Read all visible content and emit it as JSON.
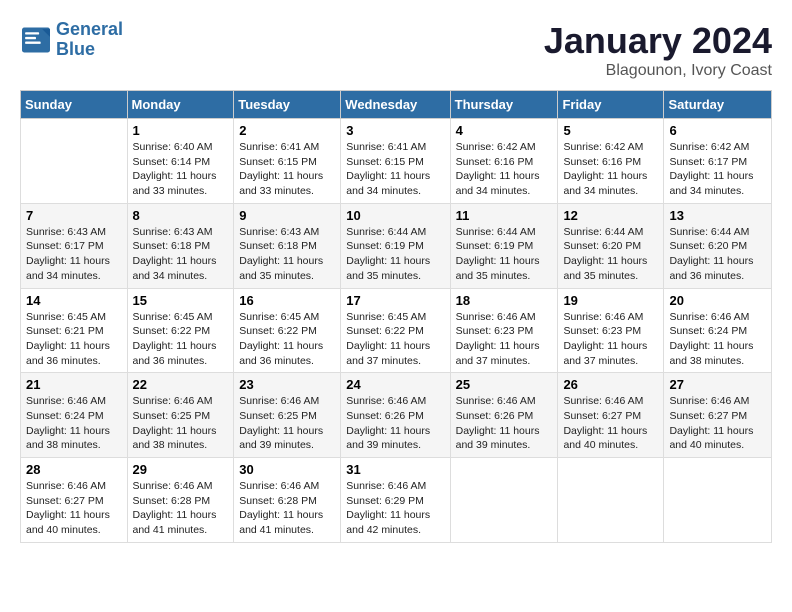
{
  "header": {
    "logo_line1": "General",
    "logo_line2": "Blue",
    "month": "January 2024",
    "location": "Blagounon, Ivory Coast"
  },
  "days_of_week": [
    "Sunday",
    "Monday",
    "Tuesday",
    "Wednesday",
    "Thursday",
    "Friday",
    "Saturday"
  ],
  "weeks": [
    [
      {
        "day": null
      },
      {
        "day": "1",
        "sunrise": "6:40 AM",
        "sunset": "6:14 PM",
        "daylight": "11 hours and 33 minutes."
      },
      {
        "day": "2",
        "sunrise": "6:41 AM",
        "sunset": "6:15 PM",
        "daylight": "11 hours and 33 minutes."
      },
      {
        "day": "3",
        "sunrise": "6:41 AM",
        "sunset": "6:15 PM",
        "daylight": "11 hours and 34 minutes."
      },
      {
        "day": "4",
        "sunrise": "6:42 AM",
        "sunset": "6:16 PM",
        "daylight": "11 hours and 34 minutes."
      },
      {
        "day": "5",
        "sunrise": "6:42 AM",
        "sunset": "6:16 PM",
        "daylight": "11 hours and 34 minutes."
      },
      {
        "day": "6",
        "sunrise": "6:42 AM",
        "sunset": "6:17 PM",
        "daylight": "11 hours and 34 minutes."
      }
    ],
    [
      {
        "day": "7",
        "sunrise": "6:43 AM",
        "sunset": "6:17 PM",
        "daylight": "11 hours and 34 minutes."
      },
      {
        "day": "8",
        "sunrise": "6:43 AM",
        "sunset": "6:18 PM",
        "daylight": "11 hours and 34 minutes."
      },
      {
        "day": "9",
        "sunrise": "6:43 AM",
        "sunset": "6:18 PM",
        "daylight": "11 hours and 35 minutes."
      },
      {
        "day": "10",
        "sunrise": "6:44 AM",
        "sunset": "6:19 PM",
        "daylight": "11 hours and 35 minutes."
      },
      {
        "day": "11",
        "sunrise": "6:44 AM",
        "sunset": "6:19 PM",
        "daylight": "11 hours and 35 minutes."
      },
      {
        "day": "12",
        "sunrise": "6:44 AM",
        "sunset": "6:20 PM",
        "daylight": "11 hours and 35 minutes."
      },
      {
        "day": "13",
        "sunrise": "6:44 AM",
        "sunset": "6:20 PM",
        "daylight": "11 hours and 36 minutes."
      }
    ],
    [
      {
        "day": "14",
        "sunrise": "6:45 AM",
        "sunset": "6:21 PM",
        "daylight": "11 hours and 36 minutes."
      },
      {
        "day": "15",
        "sunrise": "6:45 AM",
        "sunset": "6:22 PM",
        "daylight": "11 hours and 36 minutes."
      },
      {
        "day": "16",
        "sunrise": "6:45 AM",
        "sunset": "6:22 PM",
        "daylight": "11 hours and 36 minutes."
      },
      {
        "day": "17",
        "sunrise": "6:45 AM",
        "sunset": "6:22 PM",
        "daylight": "11 hours and 37 minutes."
      },
      {
        "day": "18",
        "sunrise": "6:46 AM",
        "sunset": "6:23 PM",
        "daylight": "11 hours and 37 minutes."
      },
      {
        "day": "19",
        "sunrise": "6:46 AM",
        "sunset": "6:23 PM",
        "daylight": "11 hours and 37 minutes."
      },
      {
        "day": "20",
        "sunrise": "6:46 AM",
        "sunset": "6:24 PM",
        "daylight": "11 hours and 38 minutes."
      }
    ],
    [
      {
        "day": "21",
        "sunrise": "6:46 AM",
        "sunset": "6:24 PM",
        "daylight": "11 hours and 38 minutes."
      },
      {
        "day": "22",
        "sunrise": "6:46 AM",
        "sunset": "6:25 PM",
        "daylight": "11 hours and 38 minutes."
      },
      {
        "day": "23",
        "sunrise": "6:46 AM",
        "sunset": "6:25 PM",
        "daylight": "11 hours and 39 minutes."
      },
      {
        "day": "24",
        "sunrise": "6:46 AM",
        "sunset": "6:26 PM",
        "daylight": "11 hours and 39 minutes."
      },
      {
        "day": "25",
        "sunrise": "6:46 AM",
        "sunset": "6:26 PM",
        "daylight": "11 hours and 39 minutes."
      },
      {
        "day": "26",
        "sunrise": "6:46 AM",
        "sunset": "6:27 PM",
        "daylight": "11 hours and 40 minutes."
      },
      {
        "day": "27",
        "sunrise": "6:46 AM",
        "sunset": "6:27 PM",
        "daylight": "11 hours and 40 minutes."
      }
    ],
    [
      {
        "day": "28",
        "sunrise": "6:46 AM",
        "sunset": "6:27 PM",
        "daylight": "11 hours and 40 minutes."
      },
      {
        "day": "29",
        "sunrise": "6:46 AM",
        "sunset": "6:28 PM",
        "daylight": "11 hours and 41 minutes."
      },
      {
        "day": "30",
        "sunrise": "6:46 AM",
        "sunset": "6:28 PM",
        "daylight": "11 hours and 41 minutes."
      },
      {
        "day": "31",
        "sunrise": "6:46 AM",
        "sunset": "6:29 PM",
        "daylight": "11 hours and 42 minutes."
      },
      {
        "day": null
      },
      {
        "day": null
      },
      {
        "day": null
      }
    ]
  ]
}
